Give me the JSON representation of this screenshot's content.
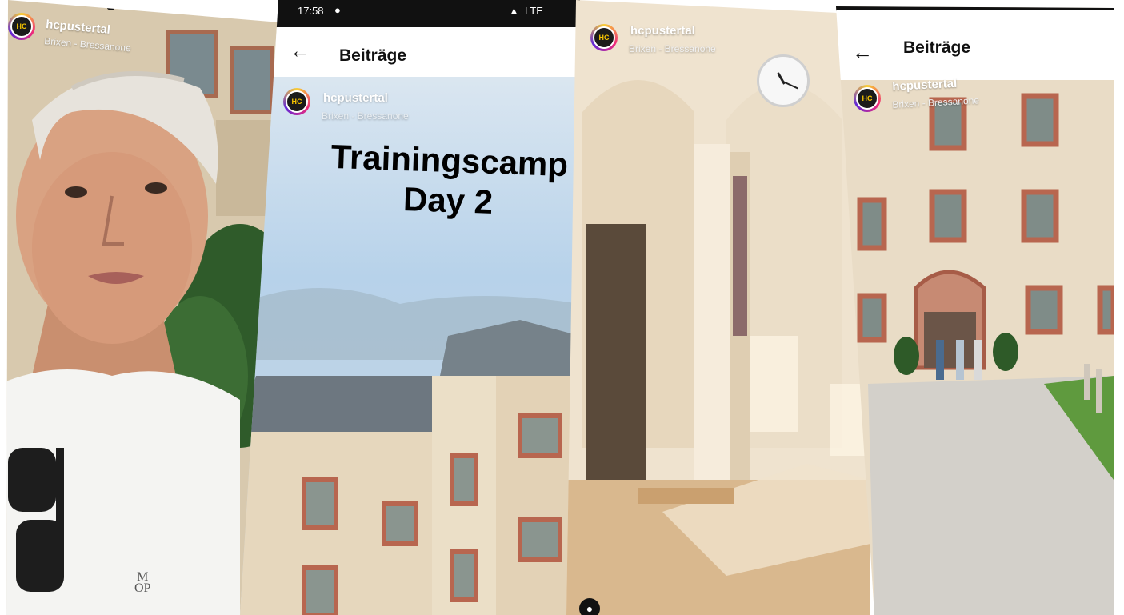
{
  "colors": {
    "status_bar": "#111111",
    "appbar_bg": "#ffffff",
    "facade_cream": "#e9dcc6",
    "facade_trim": "#b8664f",
    "sky_blue": "#b7d2ea",
    "corridor_wall": "#efe3cf",
    "floor_tan": "#d9b88e"
  },
  "panel1": {
    "header_partial": "age",
    "username": "hcpustertal",
    "location": "Brixen - Bressanone",
    "shirt_logo_line1": "M",
    "shirt_logo_line2": "OP",
    "icons": [
      "profile-avatar-icon"
    ]
  },
  "panel2": {
    "status_time": "17:58",
    "status_right": "LTE",
    "appbar_title": "Beiträge",
    "username": "hcpustertal",
    "location": "Brixen - Bressanone",
    "overlay_line1": "Trainingscamp",
    "overlay_line2": "Day 2",
    "icons": [
      "back-arrow-icon",
      "profile-avatar-icon",
      "location-pin-icon",
      "signal-icon"
    ]
  },
  "panel3": {
    "username": "hcpustertal",
    "location": "Brixen - Bressanone",
    "icons": [
      "profile-avatar-icon",
      "wall-clock-icon",
      "user-tag-icon"
    ]
  },
  "panel4": {
    "appbar_title": "Beiträge",
    "username": "hcpustertal",
    "location": "Brixen - Bressanone",
    "icons": [
      "back-arrow-icon",
      "profile-avatar-icon"
    ]
  }
}
